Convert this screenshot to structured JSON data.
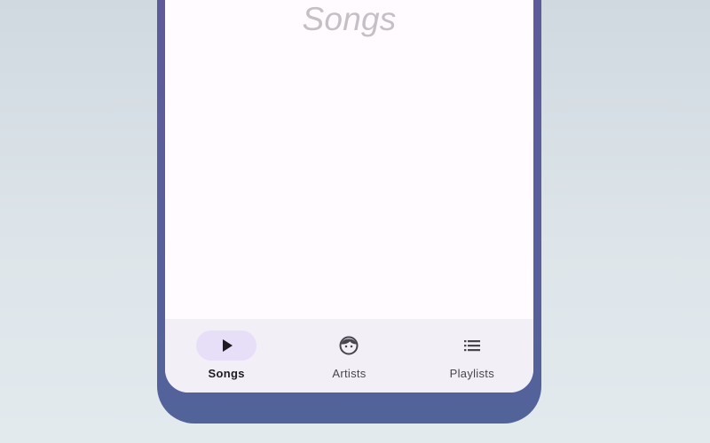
{
  "screen": {
    "title": "Songs"
  },
  "nav": {
    "items": [
      {
        "label": "Songs",
        "icon": "play-icon",
        "active": true
      },
      {
        "label": "Artists",
        "icon": "face-icon",
        "active": false
      },
      {
        "label": "Playlists",
        "icon": "list-icon",
        "active": false
      }
    ]
  },
  "colors": {
    "device_frame": "#5a5e9d",
    "screen_background": "#fffbfe",
    "nav_background": "#f3eff7",
    "active_indicator": "#e7def8",
    "icon": "#1d1b20",
    "title": "#c3c1c6"
  }
}
